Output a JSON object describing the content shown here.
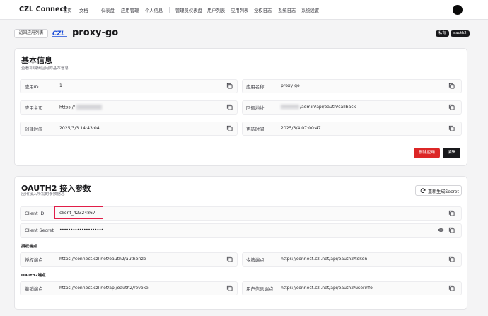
{
  "brand": "CZL Connect",
  "nav": [
    "首页",
    "文档",
    "仪表盘",
    "应用管理",
    "个人信息",
    "管理员仪表盘",
    "用户列表",
    "应用列表",
    "授权日志",
    "系统日志",
    "系统设置"
  ],
  "back_button": "返回应用列表",
  "app": {
    "name": "proxy-go",
    "logo_text": "CZL",
    "tags": [
      "私有",
      "oauth2"
    ]
  },
  "basic": {
    "title": "基本信息",
    "subtitle": "查看和编辑应用的基本信息",
    "fields": {
      "app_id": {
        "label": "应用ID",
        "value": "1"
      },
      "app_name": {
        "label": "应用名称",
        "value": "proxy-go"
      },
      "homepage": {
        "label": "应用主页",
        "value": "https://"
      },
      "callback": {
        "label": "回调地址",
        "value": "/admin/api/oauth/callback"
      },
      "created": {
        "label": "创建时间",
        "value": "2025/3/3 14:43:04"
      },
      "updated": {
        "label": "更新时间",
        "value": "2025/3/4 07:00:47"
      }
    },
    "delete_button": "删除应用",
    "edit_button": "编辑"
  },
  "oauth": {
    "title": "OAUTH2 接入参数",
    "subtitle": "应用接入所需的参数信息",
    "regen_button": "重新生成Secret",
    "client_id": {
      "label": "Client ID",
      "value": "client_42324867"
    },
    "client_secret": {
      "label": "Client Secret",
      "value": "••••••••••••••••••••"
    },
    "endpoints_label": "授权端点",
    "authorize": {
      "label": "授权端点",
      "value": "https://connect.czl.net/oauth2/authorize"
    },
    "token": {
      "label": "令牌端点",
      "value": "https://connect.czl.net/api/oauth2/token"
    },
    "oauth2_endpoints_label": "OAuth2端点",
    "revoke": {
      "label": "撤销端点",
      "value": "https://connect.czl.net/api/oauth2/revoke"
    },
    "userinfo": {
      "label": "用户信息端点",
      "value": "https://connect.czl.net/api/oauth2/userinfo"
    }
  },
  "colors": {
    "danger": "#dc2626",
    "dark": "#18181b",
    "highlight": "#e11d48",
    "logo": "#1d4ed8"
  }
}
